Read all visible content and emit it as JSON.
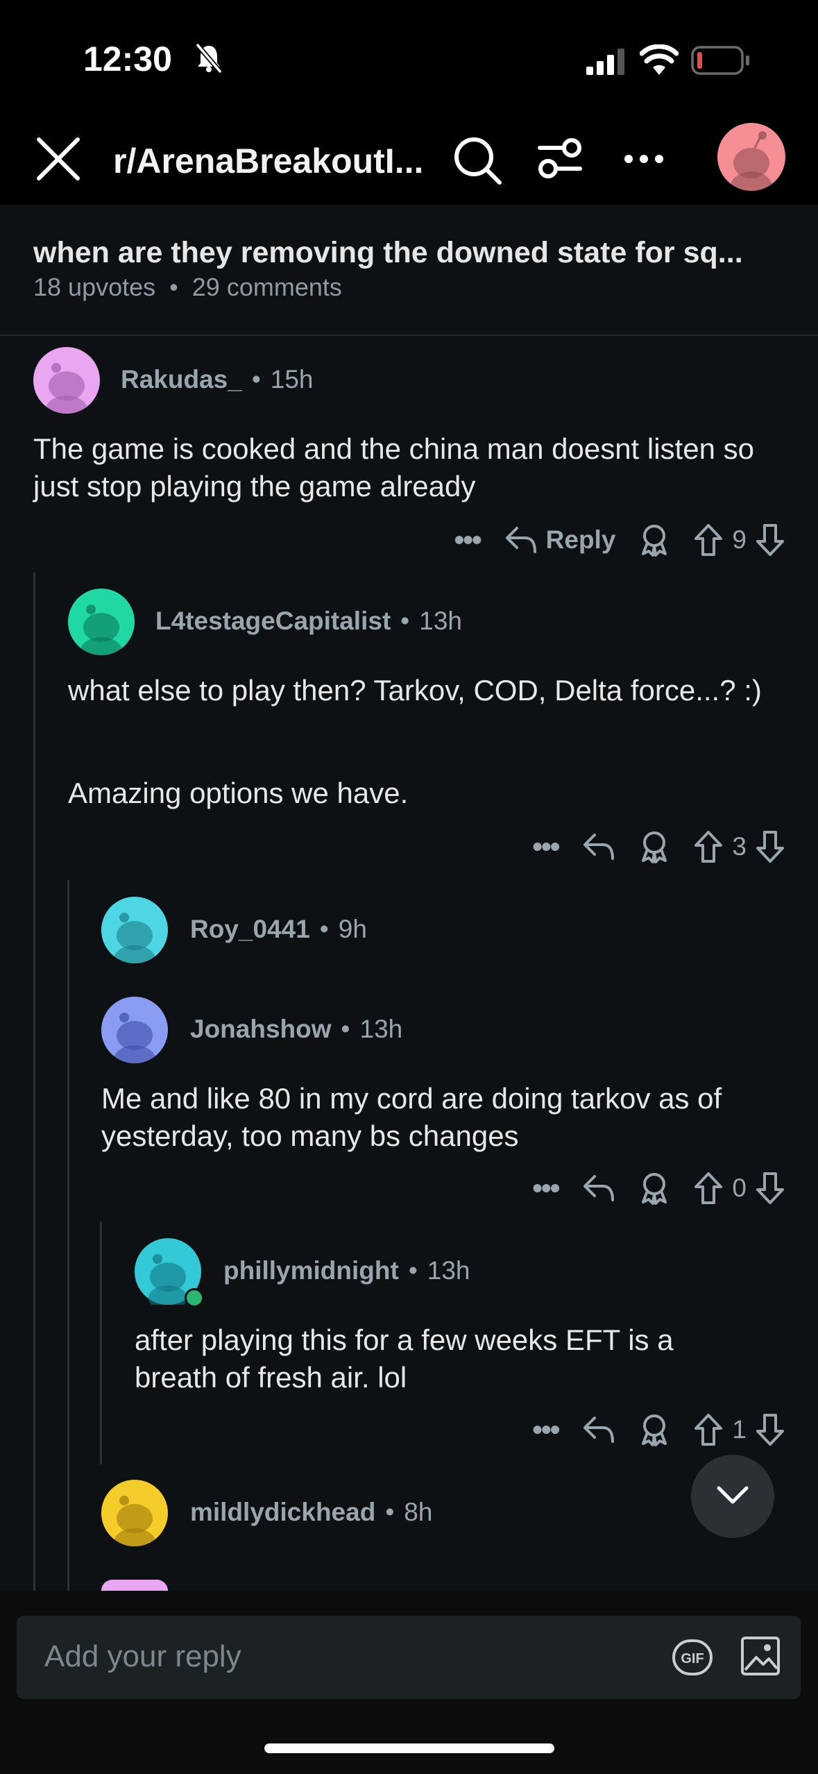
{
  "status_bar": {
    "time": "12:30"
  },
  "header": {
    "subreddit": "r/ArenaBreakoutI..."
  },
  "post": {
    "title": "when are they removing the downed state for sq...",
    "upvotes": "18 upvotes",
    "separator": "•",
    "comments": "29 comments"
  },
  "comments": [
    {
      "user": "Rakudas_",
      "age": "15h",
      "avatar_color": "#e9a7f2",
      "text": "The game is cooked and the china man doesnt listen so just stop playing the game already",
      "reply_label": "Reply",
      "votes": "9"
    },
    {
      "user": "L4testageCapitalist",
      "age": "13h",
      "avatar_color": "#1fd8a4",
      "text_lines": [
        "what else to play then? Tarkov, COD, Delta force...? :)",
        "Amazing options we have."
      ],
      "votes": "3"
    },
    {
      "user": "Roy_0441",
      "age": "9h",
      "avatar_color": "#4fd6e4"
    },
    {
      "user": "Jonahshow",
      "age": "13h",
      "avatar_color": "#8a9bf2",
      "text": "Me and like 80 in my cord are doing tarkov as of yesterday, too many bs changes",
      "votes": "0"
    },
    {
      "user": "phillymidnight",
      "age": "13h",
      "avatar_color": "#33c9d6",
      "text": "after playing this for a few weeks EFT is a breath of fresh air. lol",
      "votes": "1"
    },
    {
      "user": "mildlydickhead",
      "age": "8h",
      "avatar_color": "#f5cd2b"
    }
  ],
  "composer": {
    "placeholder": "Add your reply"
  },
  "icons": {
    "close": "close-icon",
    "search": "search-icon",
    "filter": "filter-icon",
    "more": "more-icon",
    "reply": "reply-icon",
    "award": "award-icon",
    "upvote": "upvote-icon",
    "downvote": "downvote-icon",
    "gif": "gif-icon",
    "image": "image-icon",
    "scroll": "chevron-down-icon"
  },
  "colors": {
    "background": "#0e1113",
    "online": "#2bb673",
    "battery_low": "#e5484d"
  }
}
